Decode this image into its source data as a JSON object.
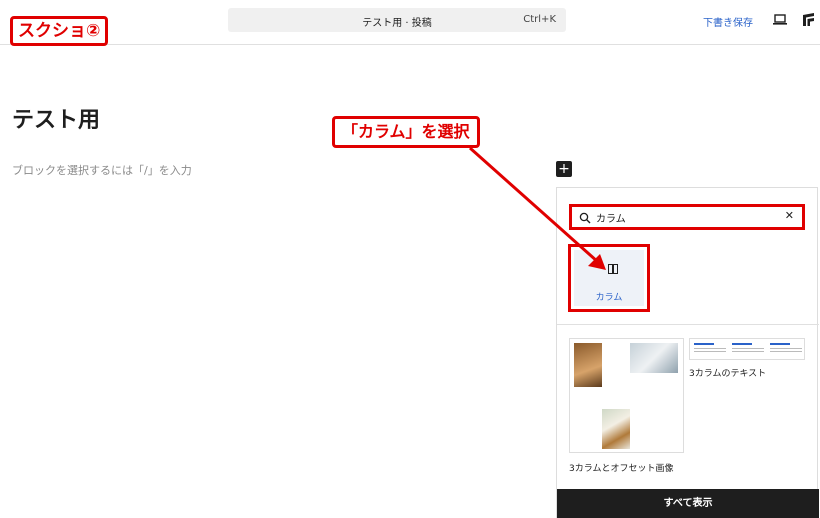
{
  "annotations": {
    "screenshot_label": "スクショ②",
    "instruction": "「カラム」を選択"
  },
  "header": {
    "command_title": "テスト用 · 投稿",
    "command_shortcut": "Ctrl+K",
    "save_draft": "下書き保存"
  },
  "editor": {
    "post_title": "テスト用",
    "block_placeholder": "ブロックを選択するには「/」を入力"
  },
  "inserter": {
    "search_value": "カラム",
    "block_result": "カラム",
    "patterns": [
      "3カラムとオフセット画像",
      "3カラムのテキスト"
    ],
    "show_all": "すべて表示"
  },
  "colors": {
    "accent": "#2a62c9",
    "annotation": "#e00000",
    "dark": "#1e1e1e"
  }
}
